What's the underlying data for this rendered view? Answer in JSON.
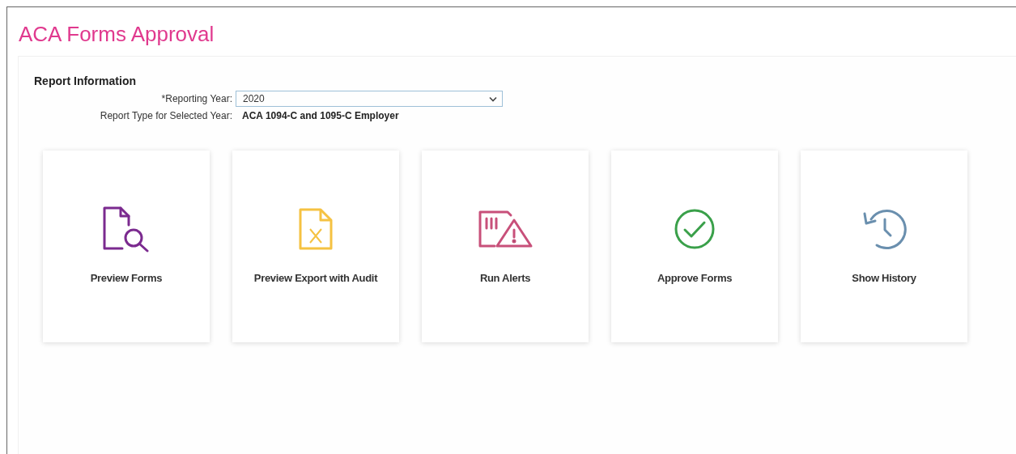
{
  "page_title": "ACA Forms Approval",
  "report_information": {
    "heading": "Report Information",
    "reporting_year": {
      "label": "*Reporting Year:",
      "value": "2020"
    },
    "report_type": {
      "label": "Report Type for Selected Year:",
      "value": "ACA 1094-C and 1095-C Employer"
    }
  },
  "actions": [
    {
      "label": "Preview Forms",
      "kind": "preview",
      "color": "#7b2a8f"
    },
    {
      "label": "Preview Export with Audit",
      "kind": "export",
      "color": "#f5c242"
    },
    {
      "label": "Run Alerts",
      "kind": "alerts",
      "color": "#c8507a"
    },
    {
      "label": "Approve Forms",
      "kind": "approve",
      "color": "#3aa04a"
    },
    {
      "label": "Show History",
      "kind": "history",
      "color": "#6a8fae"
    }
  ]
}
